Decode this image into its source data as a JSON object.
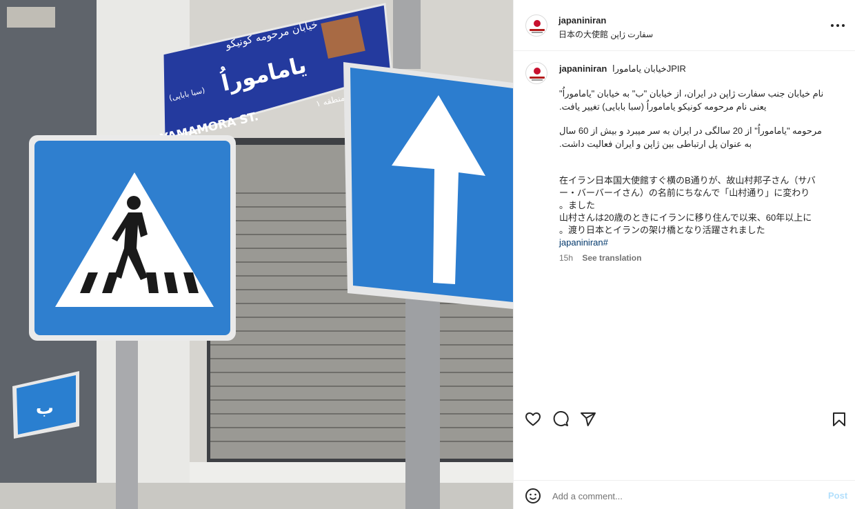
{
  "post": {
    "username": "japaniniran",
    "location": "日本の大使館 سفارت ژاپن",
    "caption_title": "خیابان یاماموراJPIR",
    "caption_lines": [
      "نام خیابان جنب سفارت ژاپن در ایران، از خیابان \"ب\" به خیابان \"یاماموراُ\"",
      "یعنی نام مرحومه کونیکو یاماموراُ (سبا بابایی) تغییر یافت.",
      "",
      "مرحومه \"یاماموراُ\" از 20 سالگی در ایران به سر میبرد و بیش از 60 سال",
      "به عنوان پل ارتباطی بین ژاپن و ایران فعالیت داشت.",
      "",
      "",
      "在イラン日本国大使館すぐ横のB通りが、故山村邦子さん（サバ",
      "ー・バーバーイさん）の名前にちなんで「山村通り」に変わり",
      "。ました",
      "山村さんは20歳のときにイランに移り住んで以来、60年以上に",
      "。渡り日本とイランの架け橋となり活躍されました"
    ],
    "hashtag": "japaniniran#",
    "time_ago": "15h",
    "see_translation": "See translation"
  },
  "comment": {
    "placeholder": "Add a comment...",
    "post_label": "Post"
  },
  "photo_signs": {
    "street_name_fa_top": "خیابان مرحومه کونیکو",
    "street_name_fa_main": "یاماموراُ",
    "street_name_fa_sub": "(سبا بابایی)",
    "street_name_en": "YAMAMORA ST.",
    "street_number": "منطقه ۱",
    "small_sign_letter": "ب"
  },
  "icons": {
    "more": "more-options-icon",
    "like": "heart-icon",
    "comment": "comment-icon",
    "share": "share-icon",
    "save": "bookmark-icon",
    "emoji": "emoji-icon"
  },
  "colors": {
    "sign_blue": "#2a7fd0",
    "street_sign_blue": "#2b3da4",
    "link": "#00376b",
    "muted": "#737373",
    "post_button": "#b2dffc"
  }
}
